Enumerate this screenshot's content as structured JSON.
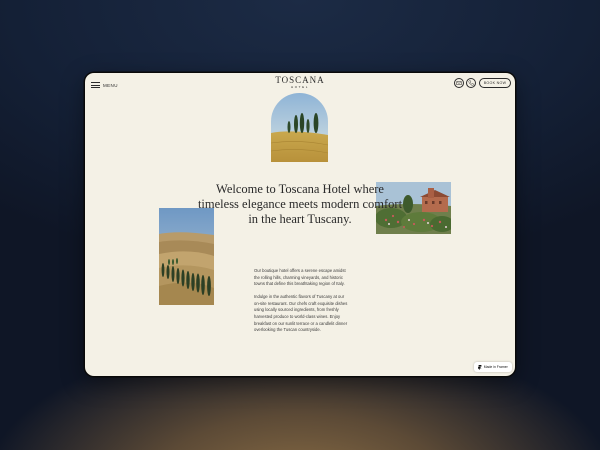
{
  "header": {
    "menu_label": "MENU",
    "logo_main": "TOSCANA",
    "logo_sub": "HOTEL",
    "book_label": "BOOK NOW"
  },
  "icons": {
    "menu": "hamburger-icon",
    "mail": "mail-icon",
    "phone": "phone-icon",
    "framer": "framer-icon"
  },
  "main": {
    "headline": "Welcome to Toscana Hotel where timeless elegance meets modern comfort in the heart Tuscany.",
    "paragraphs": [
      "Our boutique hotel offers a serene escape amidst the rolling hills, charming vineyards, and historic towns that define this breathtaking region of Italy.",
      "Indulge in the authentic flavors of Tuscany at our on-site restaurant. Our chefs craft exquisite dishes using locally sourced ingredients, from freshly harvested produce to world-class wines. Enjoy breakfast on our sunlit terrace or a candlelit dinner overlooking the Tuscan countryside."
    ]
  },
  "badge": {
    "label": "Made in Framer"
  },
  "colors": {
    "page_background": "#f4f1e6",
    "text": "#2a2a2a"
  }
}
